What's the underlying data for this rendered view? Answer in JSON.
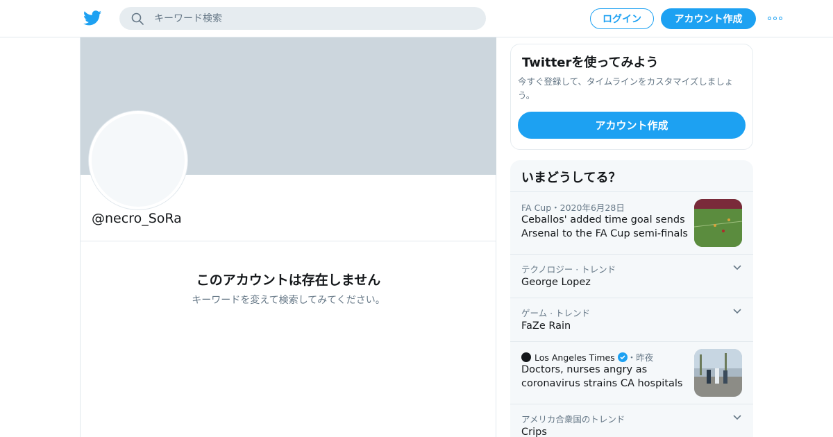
{
  "header": {
    "search_placeholder": "キーワード検索",
    "login_label": "ログイン",
    "signup_label": "アカウント作成",
    "accent_color": "#1da1f2"
  },
  "profile": {
    "handle": "@necro_SoRa",
    "empty_title": "このアカウントは存在しません",
    "empty_subtitle": "キーワードを変えて検索してみてください。"
  },
  "signup_card": {
    "title": "Twitterを使ってみよう",
    "description": "今すぐ登録して、タイムラインをカスタマイズしましょう。",
    "button_label": "アカウント作成"
  },
  "trends": {
    "title": "いまどうしてる？",
    "items": [
      {
        "meta": "FA Cup・2020年6月28日",
        "headline": "Ceballos' added time goal sends Arsenal to the FA Cup semi-finals",
        "thumbnail": "football-match-photo"
      },
      {
        "meta": "テクノロジー · トレンド",
        "headline": "George Lopez",
        "icon": "chevron-down-icon"
      },
      {
        "meta": "ゲーム · トレンド",
        "headline": "FaZe Rain",
        "icon": "chevron-down-icon"
      },
      {
        "source": "Los Angeles Times",
        "time": "・昨夜",
        "headline": "Doctors, nurses angry as coronavirus strains CA hospitals",
        "thumbnail": "protest-photo"
      },
      {
        "meta": "アメリカ合衆国のトレンド",
        "headline": "Crips",
        "icon": "chevron-down-icon"
      }
    ]
  }
}
